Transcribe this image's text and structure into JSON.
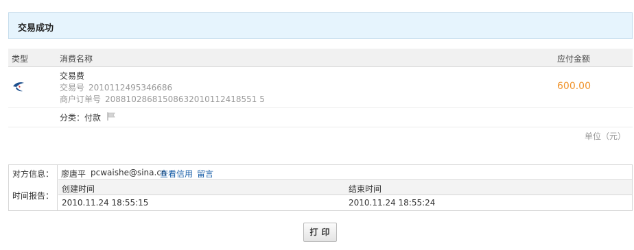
{
  "banner": {
    "title": "交易成功"
  },
  "table": {
    "headers": {
      "type": "类型",
      "name": "消费名称",
      "amount": "应付金额"
    },
    "item": {
      "name": "交易费",
      "trade_no_label": "交易号",
      "trade_no": "2010112495346686",
      "order_no_label": "商户订单号",
      "order_no": "20881028681508632010112418551 5",
      "amount": "600.00",
      "type_icon": "bird-icon"
    },
    "category": {
      "label": "分类：付款",
      "icon": "flag-icon"
    },
    "unit_note": "单位（元）"
  },
  "info": {
    "counterparty_label": "对方信息：",
    "counterparty_name": "廖唐平",
    "counterparty_email": "pcwaishe@sina.cn",
    "view_credit_link": "查看信用",
    "message_link": "留言",
    "time_label": "时间报告：",
    "created_header": "创建时间",
    "ended_header": "结束时间",
    "created_value": "2010.11.24 18:55:15",
    "ended_value": "2010.11.24 18:55:24"
  },
  "actions": {
    "print_label": "打印"
  },
  "colors": {
    "banner_bg": "#e6f4fd",
    "amount": "#f0932b",
    "link": "#1a5fa8"
  }
}
